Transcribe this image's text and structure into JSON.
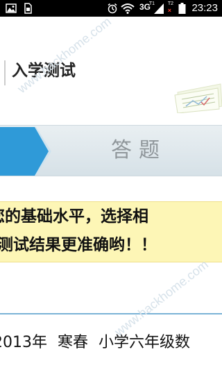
{
  "status_bar": {
    "time": "23:23",
    "network_type": "3G",
    "network_superscript": "T1",
    "sim2_label": "T2",
    "sim2_no_signal": "×"
  },
  "header": {
    "title": "入学测试"
  },
  "progress": {
    "current_step_label": "答题"
  },
  "notice": {
    "line1": "您的基础水平，选择相",
    "line2": "测试结果更准确哟！！"
  },
  "list": {
    "items": [
      {
        "year": "2013年",
        "season": "寒春",
        "course": "小学六年级数"
      }
    ]
  },
  "watermark": {
    "text": "www.hackhome.com"
  },
  "colors": {
    "status_bar_bg": "#000000",
    "step_arrow_blue": "#2f9ad8",
    "notice_bg": "#fdf6b6",
    "list_divider": "#7ab3d6"
  }
}
